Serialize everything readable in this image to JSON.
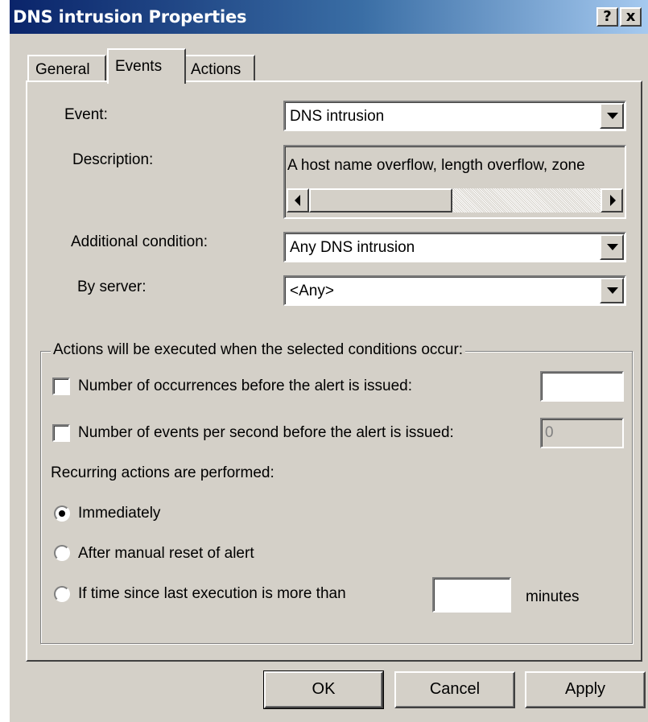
{
  "window": {
    "title": "DNS intrusion Properties",
    "help_button": "?",
    "close_button": "x"
  },
  "tabs": [
    {
      "label": "General",
      "selected": false
    },
    {
      "label": "Events",
      "selected": true
    },
    {
      "label": "Actions",
      "selected": false
    }
  ],
  "events": {
    "event_label": "Event:",
    "event_value": "DNS intrusion",
    "description_label": "Description:",
    "description_value": "A host name overflow, length overflow, zone",
    "additional_condition_label": "Additional condition:",
    "additional_condition_value": "Any DNS intrusion",
    "by_server_label": "By server:",
    "by_server_value": "<Any>"
  },
  "conditions": {
    "group_title": "Actions will be executed when the selected conditions occur:",
    "occurrences_label": "Number of occurrences before the alert is issued:",
    "occurrences_checked": false,
    "occurrences_value": "",
    "events_per_second_label": "Number of events per second before the alert is issued:",
    "events_per_second_checked": false,
    "events_per_second_value": "0",
    "recurring_label": "Recurring actions are performed:",
    "option_immediately": "Immediately",
    "option_manual_reset": "After manual reset of alert",
    "option_time_since": "If time since last execution is more than",
    "minutes_value": "",
    "minutes_label": "minutes",
    "selected_option": "Immediately"
  },
  "buttons": {
    "ok": "OK",
    "cancel": "Cancel",
    "apply": "Apply"
  },
  "colors": {
    "face": "#d4d0c8",
    "title_start": "#0a246a",
    "title_end": "#a6caf0"
  }
}
